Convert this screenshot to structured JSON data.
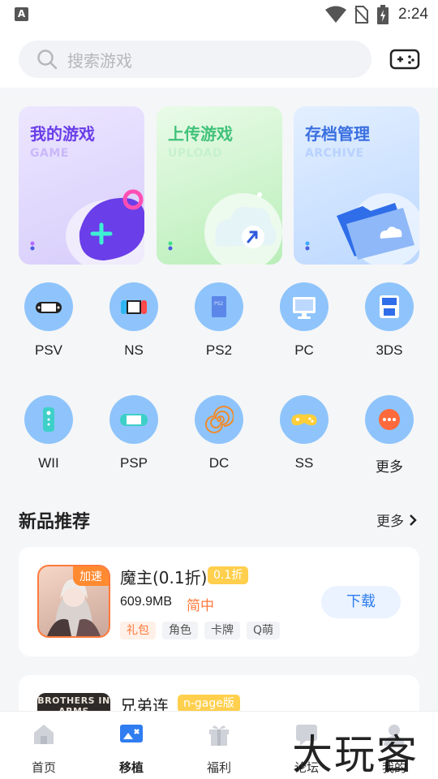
{
  "status_bar": {
    "time": "2:24",
    "left_glyph": "A"
  },
  "search": {
    "placeholder": "搜索游戏"
  },
  "feature_cards": [
    {
      "title": "我的游戏",
      "subtitle": "GAME"
    },
    {
      "title": "上传游戏",
      "subtitle": "UPLOAD"
    },
    {
      "title": "存档管理",
      "subtitle": "ARCHIVE"
    }
  ],
  "platforms": [
    {
      "label": "PSV",
      "icon": "psv-handheld-icon"
    },
    {
      "label": "NS",
      "icon": "switch-console-icon"
    },
    {
      "label": "PS2",
      "icon": "ps2-box-icon"
    },
    {
      "label": "PC",
      "icon": "monitor-icon"
    },
    {
      "label": "3DS",
      "icon": "3ds-icon"
    },
    {
      "label": "WII",
      "icon": "wii-remote-icon"
    },
    {
      "label": "PSP",
      "icon": "psp-handheld-icon"
    },
    {
      "label": "DC",
      "icon": "dreamcast-swirl-icon"
    },
    {
      "label": "SS",
      "icon": "saturn-gamepad-icon"
    },
    {
      "label": "更多",
      "icon": "more-dots-icon"
    }
  ],
  "section": {
    "title": "新品推荐",
    "more": "更多"
  },
  "games": [
    {
      "name": "魔主(0.1折)",
      "tag": "0.1折",
      "badge": "加速",
      "size": "609.9MB",
      "language": "简中",
      "chips": [
        "礼包",
        "角色",
        "卡牌",
        "Q萌"
      ],
      "button": "下载"
    },
    {
      "name": "兄弟连",
      "tag": "n-gage版",
      "thumb_text": "BROTHERS IN ARMS"
    }
  ],
  "bottom_nav": [
    {
      "label": "首页",
      "icon": "home-icon",
      "active": false
    },
    {
      "label": "移植",
      "icon": "port-icon",
      "active": true
    },
    {
      "label": "福利",
      "icon": "gift-icon",
      "active": false
    },
    {
      "label": "论坛",
      "icon": "forum-icon",
      "active": false
    },
    {
      "label": "我的",
      "icon": "profile-icon",
      "active": false
    }
  ],
  "watermark": "大玩客",
  "colors": {
    "accent": "#2f7df0",
    "orange": "#ff7a3c",
    "platform_circle": "#8ec4fb"
  }
}
